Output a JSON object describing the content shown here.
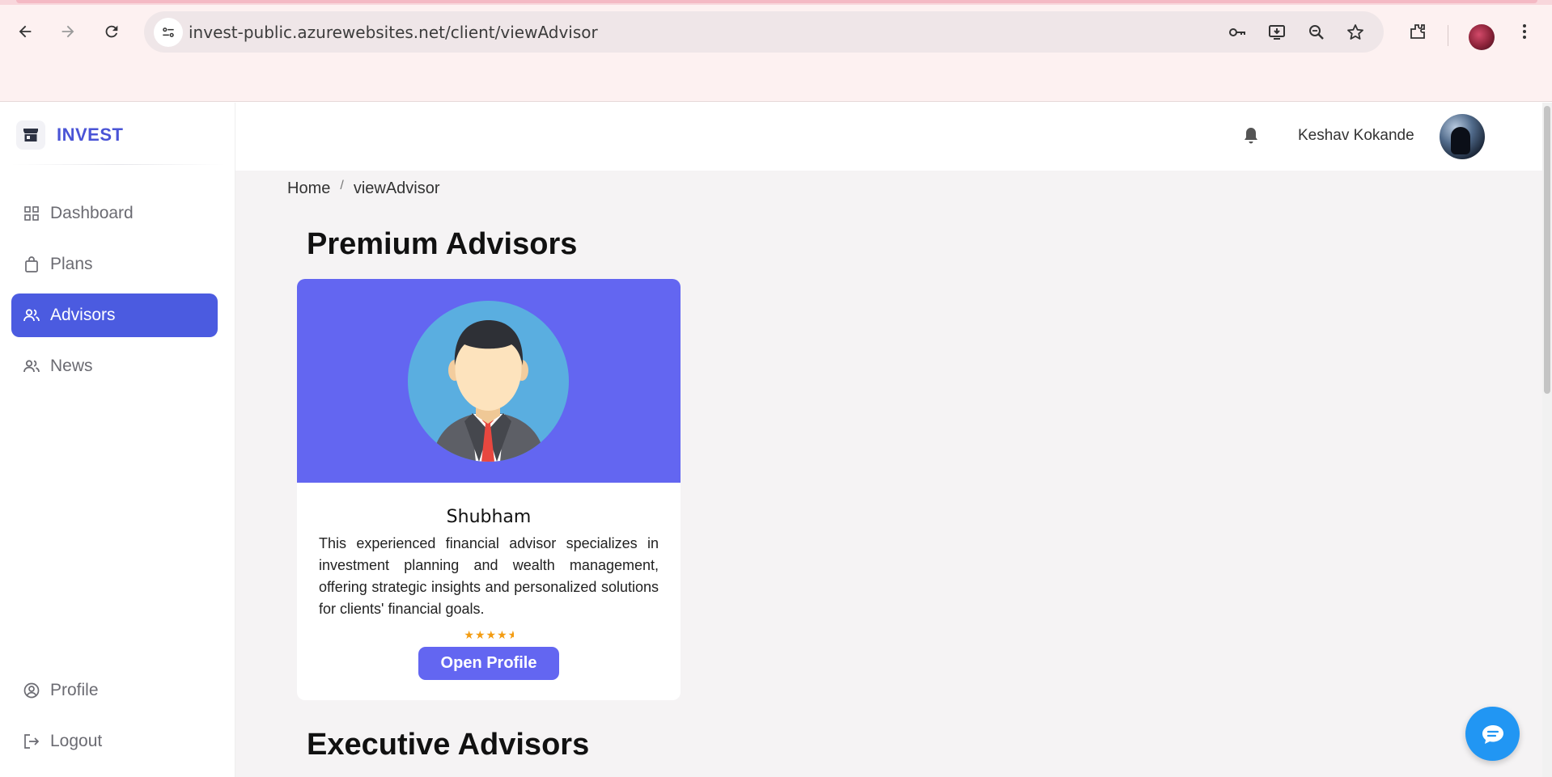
{
  "browser": {
    "url": "invest-public.azurewebsites.net/client/viewAdvisor"
  },
  "sidebar": {
    "brand": "INVEST",
    "items": [
      {
        "label": "Dashboard",
        "icon": "grid-icon"
      },
      {
        "label": "Plans",
        "icon": "shopping-bag-icon"
      },
      {
        "label": "Advisors",
        "icon": "people-icon",
        "active": true
      },
      {
        "label": "News",
        "icon": "people-icon"
      }
    ],
    "bottom_items": [
      {
        "label": "Profile",
        "icon": "user-circle-icon"
      },
      {
        "label": "Logout",
        "icon": "logout-icon"
      }
    ]
  },
  "header": {
    "username": "Keshav Kokande"
  },
  "breadcrumb": {
    "home": "Home",
    "separator": "/",
    "current": "viewAdvisor"
  },
  "sections": {
    "premium_title": "Premium Advisors",
    "executive_title": "Executive Advisors"
  },
  "advisor_card": {
    "name": "Shubham",
    "description": "This experienced financial advisor specializes in investment planning and wealth management, offering strategic insights and personalized solutions for clients' financial goals.",
    "rating": 4.5,
    "rating_stars": "★★★★★",
    "button_label": "Open Profile"
  },
  "colors": {
    "accent": "#4b5be0",
    "card_header": "#6366f1",
    "star": "#f39c12",
    "chat_button": "#2196f3"
  }
}
